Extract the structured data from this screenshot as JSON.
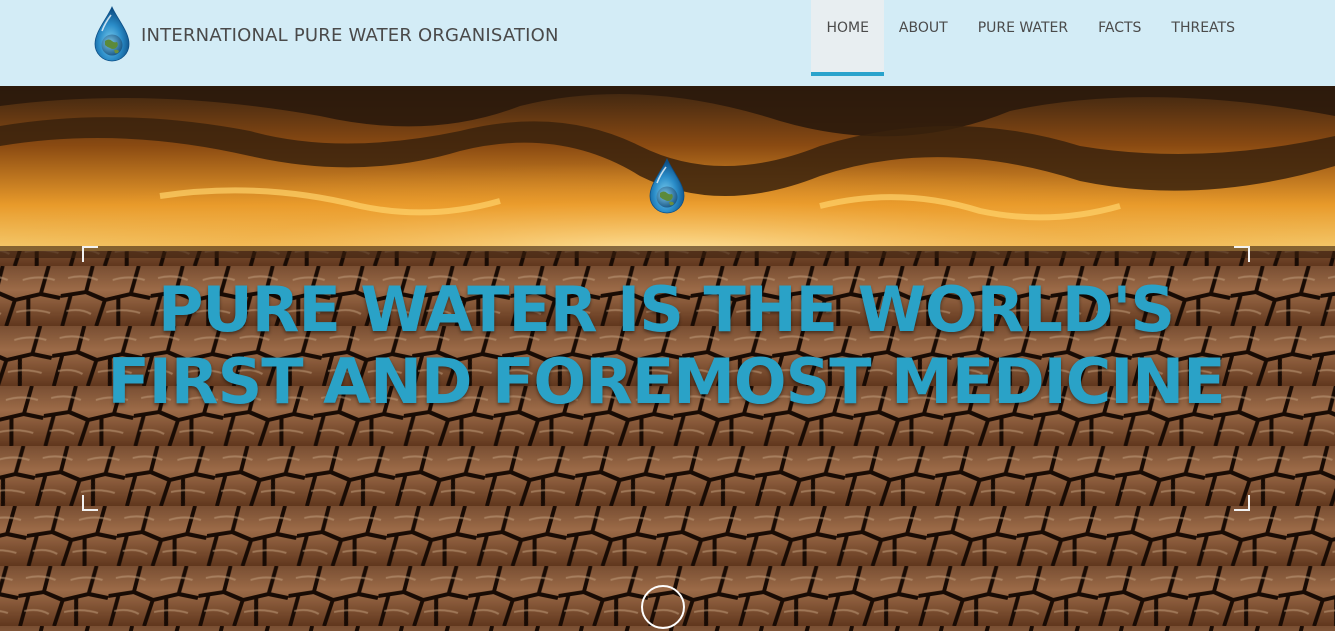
{
  "brand": {
    "name": "INTERNATIONAL PURE WATER ORGANISATION",
    "logo_icon": "water-drop-globe-icon"
  },
  "nav": {
    "items": [
      {
        "label": "HOME",
        "active": true
      },
      {
        "label": "ABOUT",
        "active": false
      },
      {
        "label": "PURE WATER",
        "active": false
      },
      {
        "label": "FACTS",
        "active": false
      },
      {
        "label": "THREATS",
        "active": false
      }
    ]
  },
  "hero": {
    "headline": "PURE WATER IS THE WORLD'S FIRST AND FOREMOST MEDICINE",
    "logo_icon": "water-drop-globe-icon",
    "scroll_icon": "scroll-down-icon"
  },
  "colors": {
    "navbar_bg": "#d3ecf6",
    "accent": "#29a3cc",
    "headline": "#2aa2c7"
  }
}
